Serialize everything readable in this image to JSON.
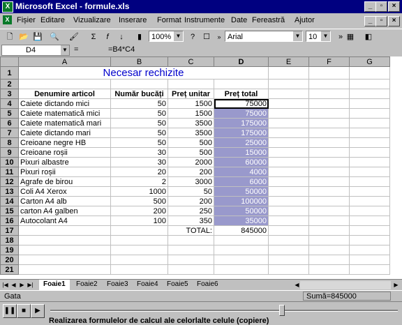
{
  "window": {
    "title": "Microsoft Excel - formule.xls",
    "app_icon": "excel-icon"
  },
  "menu": [
    "Fișier",
    "Editare",
    "Vizualizare",
    "Inserare",
    "Format",
    "Instrumente",
    "Date",
    "Fereastră",
    "Ajutor"
  ],
  "toolbar": {
    "zoom": "100%",
    "font": "Arial",
    "size": "10"
  },
  "formula_bar": {
    "cell": "D4",
    "formula": "=B4*C4"
  },
  "columns": [
    "A",
    "B",
    "C",
    "D",
    "E",
    "F",
    "G"
  ],
  "sheet": {
    "title": "Necesar rechizite",
    "headers": [
      "Denumire articol",
      "Număr bucăți",
      "Preț unitar",
      "Preț total"
    ],
    "rows": [
      [
        "Caiete dictando mici",
        "50",
        "1500",
        "75000"
      ],
      [
        "Caiete matematică mici",
        "50",
        "1500",
        "75000"
      ],
      [
        "Caiete matematică mari",
        "50",
        "3500",
        "175000"
      ],
      [
        "Caiete dictando mari",
        "50",
        "3500",
        "175000"
      ],
      [
        "Creioane negre HB",
        "50",
        "500",
        "25000"
      ],
      [
        "Creioane roșii",
        "30",
        "500",
        "15000"
      ],
      [
        "Pixuri albastre",
        "30",
        "2000",
        "60000"
      ],
      [
        "Pixuri roșii",
        "20",
        "200",
        "4000"
      ],
      [
        "Agrafe de birou",
        "2",
        "3000",
        "6000"
      ],
      [
        "Coli A4 Xerox",
        "1000",
        "50",
        "50000"
      ],
      [
        "Carton A4 alb",
        "500",
        "200",
        "100000"
      ],
      [
        "carton A4 galben",
        "200",
        "250",
        "50000"
      ],
      [
        "Autocolant A4",
        "100",
        "350",
        "35000"
      ]
    ],
    "total_label": "TOTAL:",
    "total_value": "845000"
  },
  "tabs": [
    "Foaie1",
    "Foaie2",
    "Foaie3",
    "Foaie4",
    "Foaie5",
    "Foaie6"
  ],
  "status": {
    "left": "Gata",
    "sum": "Sumă=845000"
  },
  "caption": "Realizarea formulelor de calcul ale celorlalte celule (copiere)"
}
